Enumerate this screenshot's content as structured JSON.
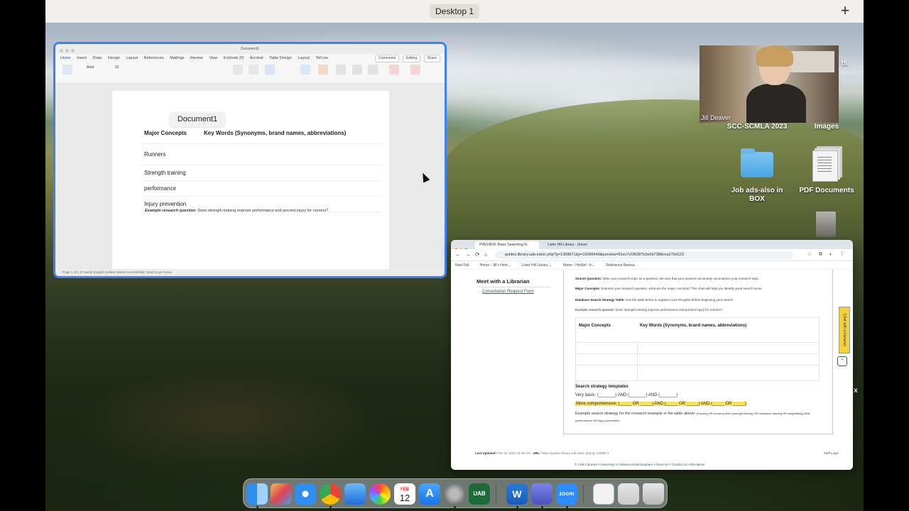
{
  "topbar": {
    "desktop_label": "Desktop 1",
    "add_label": "+"
  },
  "word": {
    "title": "Document1",
    "tabs": [
      "Home",
      "Insert",
      "Draw",
      "Design",
      "Layout",
      "References",
      "Mailings",
      "Review",
      "View",
      "Endnote 20",
      "Acrobat",
      "Table Design",
      "Layout",
      "Tell me"
    ],
    "right_buttons": [
      "Comments",
      "Editing",
      "Share"
    ],
    "font_name": "Arial",
    "font_size": "12",
    "table": {
      "col1_header": "Major Concepts",
      "col2_header": "Key Words (Synonyms, brand names, abbreviations)",
      "rows": [
        "Runners",
        "Strength training",
        "performance",
        "Injury prevention"
      ]
    },
    "example_label": "Example research question",
    "example_text": ": Does strength training improve performance and prevent injury for runners?",
    "tooltip": "Document1",
    "status": "Page 1 of 1   37 words   English (United States)   Accessibility: Good to go   Focus"
  },
  "video": {
    "name": "Jill Deaver"
  },
  "desktop_icons": {
    "scc": "SCC-SCMLA 2023",
    "images": "Images",
    "jobads": "Job ads-also in BOX",
    "pdf": "PDF Documents",
    "partial_ts": "ts",
    "partial_x": "x"
  },
  "browser": {
    "tab1": "PREVIEW: Basic Searching fo",
    "tab2": "Lister Hill Library - Univer",
    "url": "guides.library.uab.edu/c.php?g=1368871&p=10096449&preview=81ec7cf36287b3e0d7388cea276d123",
    "bookmarks": [
      "New Tab",
      "Home - Jill's Hom...",
      "Lister Hill Library ...",
      "Home - Hsclbrl - lc...",
      "Reference Resour..."
    ],
    "sidebar_title": "Meet with a Librarian",
    "sidebar_link": "Consultation Request Form",
    "guide_lines": [
      {
        "b": "Search Question:",
        "t": " Write your research topic as a question. Be sure that your question accurately summarizes your research topic."
      },
      {
        "b": "Major Concepts:",
        "t": " Examine your research question, what are the major concepts? The chart will help you identify good search terms."
      },
      {
        "b": "Database Search Strategy Table:",
        "t": " Use the table below to organize your thoughts before beginning your search."
      },
      {
        "b": "Example research question",
        "t": ": Does strength training improve performance and prevent injury for runners?"
      }
    ],
    "table_col1": "Major Concepts",
    "table_col2": "Key Words (Synonyms, brand names, abbreviations)",
    "templates_title": "Search strategy templates",
    "basic": "Very basic: (_______)  AND (_______) AND (_______)",
    "comprehensive": "More comprehensive: (_____ OR _____) AND (_____ OR _____) AND (_____ OR _____)",
    "example_strategy_label": "Example search strategy for the research example in the table above:",
    "example_strategy_text": " (Running OR runners) AND (strength training OR resistance training OR weightlifting) AND (performance OR injury prevention)",
    "chat": "Chat with a Librarian",
    "last_updated_label": "Last Updated:",
    "last_updated_value": "Feb 12, 2024 11:25 AM",
    "url_label": "URL:",
    "url_value": "https://guides.library.uab.edu/c.php?g=1368871",
    "login": "Staff Login",
    "copyright": "© UAB Libraries  •  University of Alabama at Birmingham  •  About Us  •  Contact Us  •  Disclaimer"
  },
  "dock": {
    "calendar_month": "FEB",
    "calendar_day": "12",
    "apps": [
      "Finder",
      "Launchpad",
      "Safari",
      "Chrome",
      "Preview",
      "Photos",
      "Calendar",
      "App Store",
      "System Settings",
      "UAB Information Technology",
      "Word",
      "Teams",
      "Zoom",
      "Documents",
      "Downloads",
      "Trash"
    ],
    "zoom_label": "zoom",
    "uab_label": "UAB",
    "word_label": "W"
  }
}
